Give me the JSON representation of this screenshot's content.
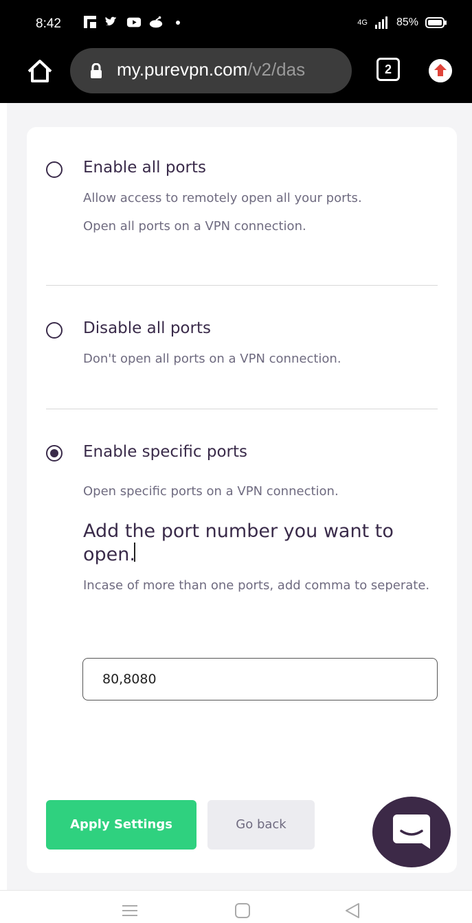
{
  "status_bar": {
    "time": "8:42",
    "notification_icons": [
      "flipboard-icon",
      "twitter-icon",
      "youtube-icon",
      "reddit-icon",
      "dot-icon"
    ],
    "network": "4G",
    "battery": "85%"
  },
  "browser": {
    "url_host": "my.purevpn.com",
    "url_path": "/v2/das",
    "tab_count": "2"
  },
  "options": [
    {
      "title": "Enable all ports",
      "descriptions": [
        "Allow access to remotely open all your ports.",
        "Open all ports on a VPN connection."
      ],
      "selected": false
    },
    {
      "title": "Disable all ports",
      "descriptions": [
        "Don't open all ports on a VPN connection."
      ],
      "selected": false
    },
    {
      "title": "Enable specific ports",
      "descriptions": [
        "Open specific ports on a VPN connection."
      ],
      "selected": true
    }
  ],
  "specific_ports": {
    "heading": "Add the port number you want to open.",
    "hint": "Incase of more than one ports, add comma to seperate.",
    "value": "80,8080"
  },
  "actions": {
    "apply_label": "Apply Settings",
    "back_label": "Go back"
  },
  "colors": {
    "accent_green": "#2fd17f",
    "text_primary": "#3a2b4a",
    "text_secondary": "#6f6b80",
    "chat_bg": "#3c2947"
  }
}
